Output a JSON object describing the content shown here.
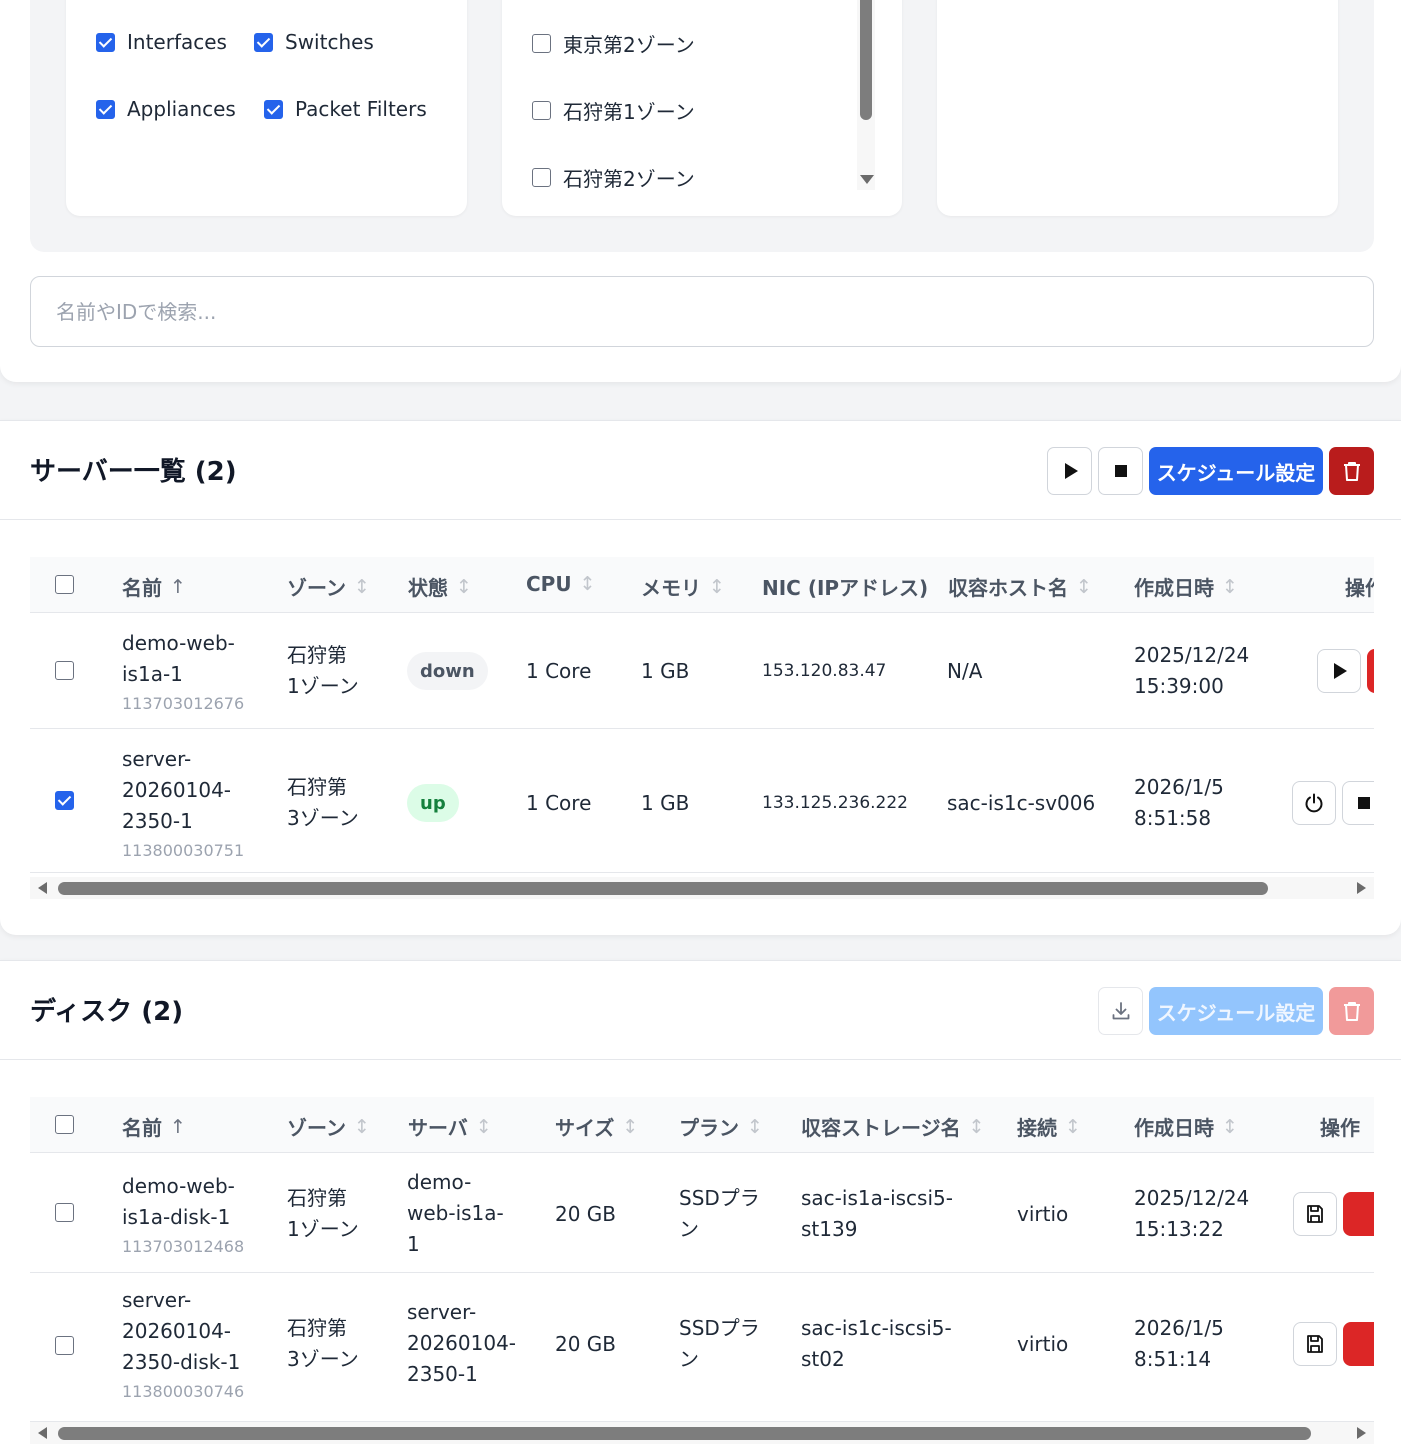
{
  "filters": {
    "types": [
      {
        "label": "Interfaces",
        "checked": true
      },
      {
        "label": "Switches",
        "checked": true
      },
      {
        "label": "Appliances",
        "checked": true
      },
      {
        "label": "Packet Filters",
        "checked": true
      }
    ],
    "zones": [
      {
        "label": "東京第2ゾーン",
        "checked": false
      },
      {
        "label": "石狩第1ゾーン",
        "checked": false
      },
      {
        "label": "石狩第2ゾーン",
        "checked": false
      }
    ]
  },
  "search": {
    "placeholder": "名前やIDで検索...",
    "value": ""
  },
  "servers": {
    "title": "サーバー一覧 (2)",
    "schedule_label": "スケジュール設定",
    "columns": [
      "名前",
      "ゾーン",
      "状態",
      "CPU",
      "メモリ",
      "NIC (IPアドレス)",
      "収容ホスト名",
      "作成日時",
      "操作"
    ],
    "rows": [
      {
        "checked": false,
        "name": [
          "demo-web-",
          "is1a-1"
        ],
        "id": "113703012676",
        "zone": [
          "石狩第",
          "1ゾーン"
        ],
        "status": "down",
        "cpu": "1 Core",
        "memory": "1 GB",
        "ip": "153.120.83.47",
        "host": "N/A",
        "created": [
          "2025/12/24",
          "15:39:00"
        ]
      },
      {
        "checked": true,
        "name": [
          "server-",
          "20260104-",
          "2350-1"
        ],
        "id": "113800030751",
        "zone": [
          "石狩第",
          "3ゾーン"
        ],
        "status": "up",
        "cpu": "1 Core",
        "memory": "1 GB",
        "ip": "133.125.236.222",
        "host": "sac-is1c-sv006",
        "created": [
          "2026/1/5",
          "8:51:58"
        ]
      }
    ]
  },
  "disks": {
    "title": "ディスク (2)",
    "schedule_label": "スケジュール設定",
    "columns": [
      "名前",
      "ゾーン",
      "サーバ",
      "サイズ",
      "プラン",
      "収容ストレージ名",
      "接続",
      "作成日時",
      "操作"
    ],
    "rows": [
      {
        "checked": false,
        "name": [
          "demo-web-",
          "is1a-disk-1"
        ],
        "id": "113703012468",
        "zone": [
          "石狩第",
          "1ゾーン"
        ],
        "server": [
          "demo-",
          "web-is1a-",
          "1"
        ],
        "size": "20 GB",
        "plan": [
          "SSDプラ",
          "ン"
        ],
        "storage": [
          "sac-is1a-iscsi5-",
          "st139"
        ],
        "connection": "virtio",
        "created": [
          "2025/12/24",
          "15:13:22"
        ]
      },
      {
        "checked": false,
        "name": [
          "server-",
          "20260104-",
          "2350-disk-1"
        ],
        "id": "113800030746",
        "zone": [
          "石狩第",
          "3ゾーン"
        ],
        "server": [
          "server-",
          "20260104-",
          "2350-1"
        ],
        "size": "20 GB",
        "plan": [
          "SSDプラ",
          "ン"
        ],
        "storage": [
          "sac-is1c-iscsi5-",
          "st02"
        ],
        "connection": "virtio",
        "created": [
          "2026/1/5",
          "8:51:14"
        ]
      }
    ]
  },
  "colors": {
    "primary": "#2563eb",
    "danger": "#b91c1c",
    "up_bg": "#dcfce7",
    "up_text": "#15803d"
  }
}
